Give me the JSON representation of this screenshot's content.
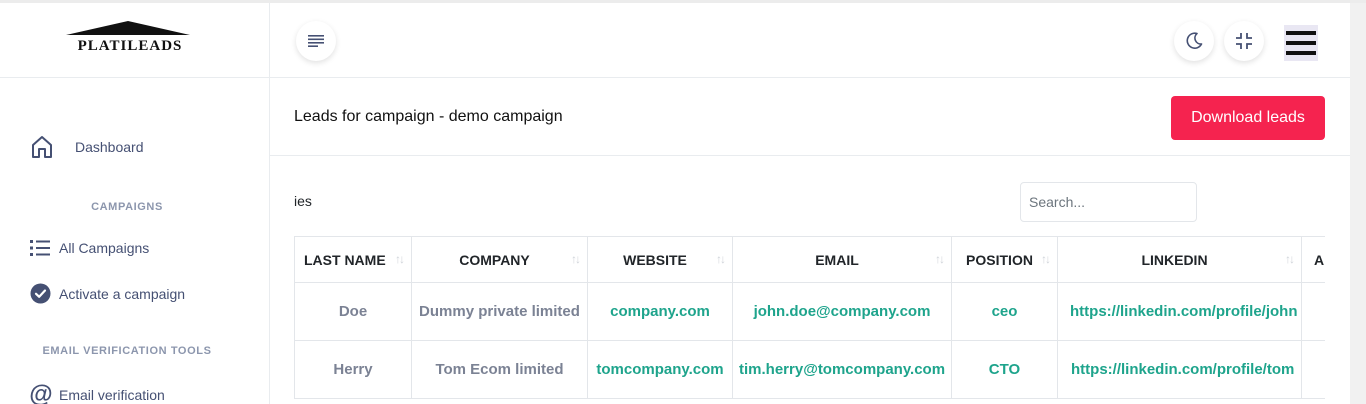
{
  "brand": {
    "name": "PLATILEADS"
  },
  "sidebar": {
    "dashboard": {
      "label": "Dashboard",
      "icon": "home-icon"
    },
    "campaigns_heading": "CAMPAIGNS",
    "all_campaigns": {
      "label": "All Campaigns",
      "icon": "list-icon"
    },
    "activate_campaign": {
      "label": "Activate a campaign",
      "icon": "check-circle-icon"
    },
    "email_tools_heading": "EMAIL VERIFICATION TOOLS",
    "email_verification": {
      "label": "Email verification",
      "icon": "at-icon"
    }
  },
  "topbar": {
    "toggle_icon": "menu-toggle-icon",
    "theme_icon": "moon-icon",
    "fullscreen_icon": "compress-icon",
    "menu_icon": "hamburger-icon"
  },
  "page": {
    "title": "Leads for campaign - demo campaign",
    "download_label": "Download leads",
    "entries_label": "ies",
    "search_placeholder": "Search..."
  },
  "table": {
    "columns": [
      "LAST NAME",
      "COMPANY",
      "WEBSITE",
      "EMAIL",
      "POSITION",
      "LINKEDIN",
      "A"
    ],
    "rows": [
      [
        "Doe",
        "Dummy private limited",
        "company.com",
        "john.doe@company.com",
        "ceo",
        "https://linkedin.com/profile/john",
        ""
      ],
      [
        "Herry",
        "Tom Ecom limited",
        "tomcompany.com",
        "tim.herry@tomcompany.com",
        "CTO",
        "https://linkedin.com/profile/tom",
        ""
      ]
    ]
  },
  "colors": {
    "accent_button": "#f5234f",
    "link_green": "#1ea48c",
    "nav_text": "#455073",
    "muted_text": "#7b8294"
  }
}
